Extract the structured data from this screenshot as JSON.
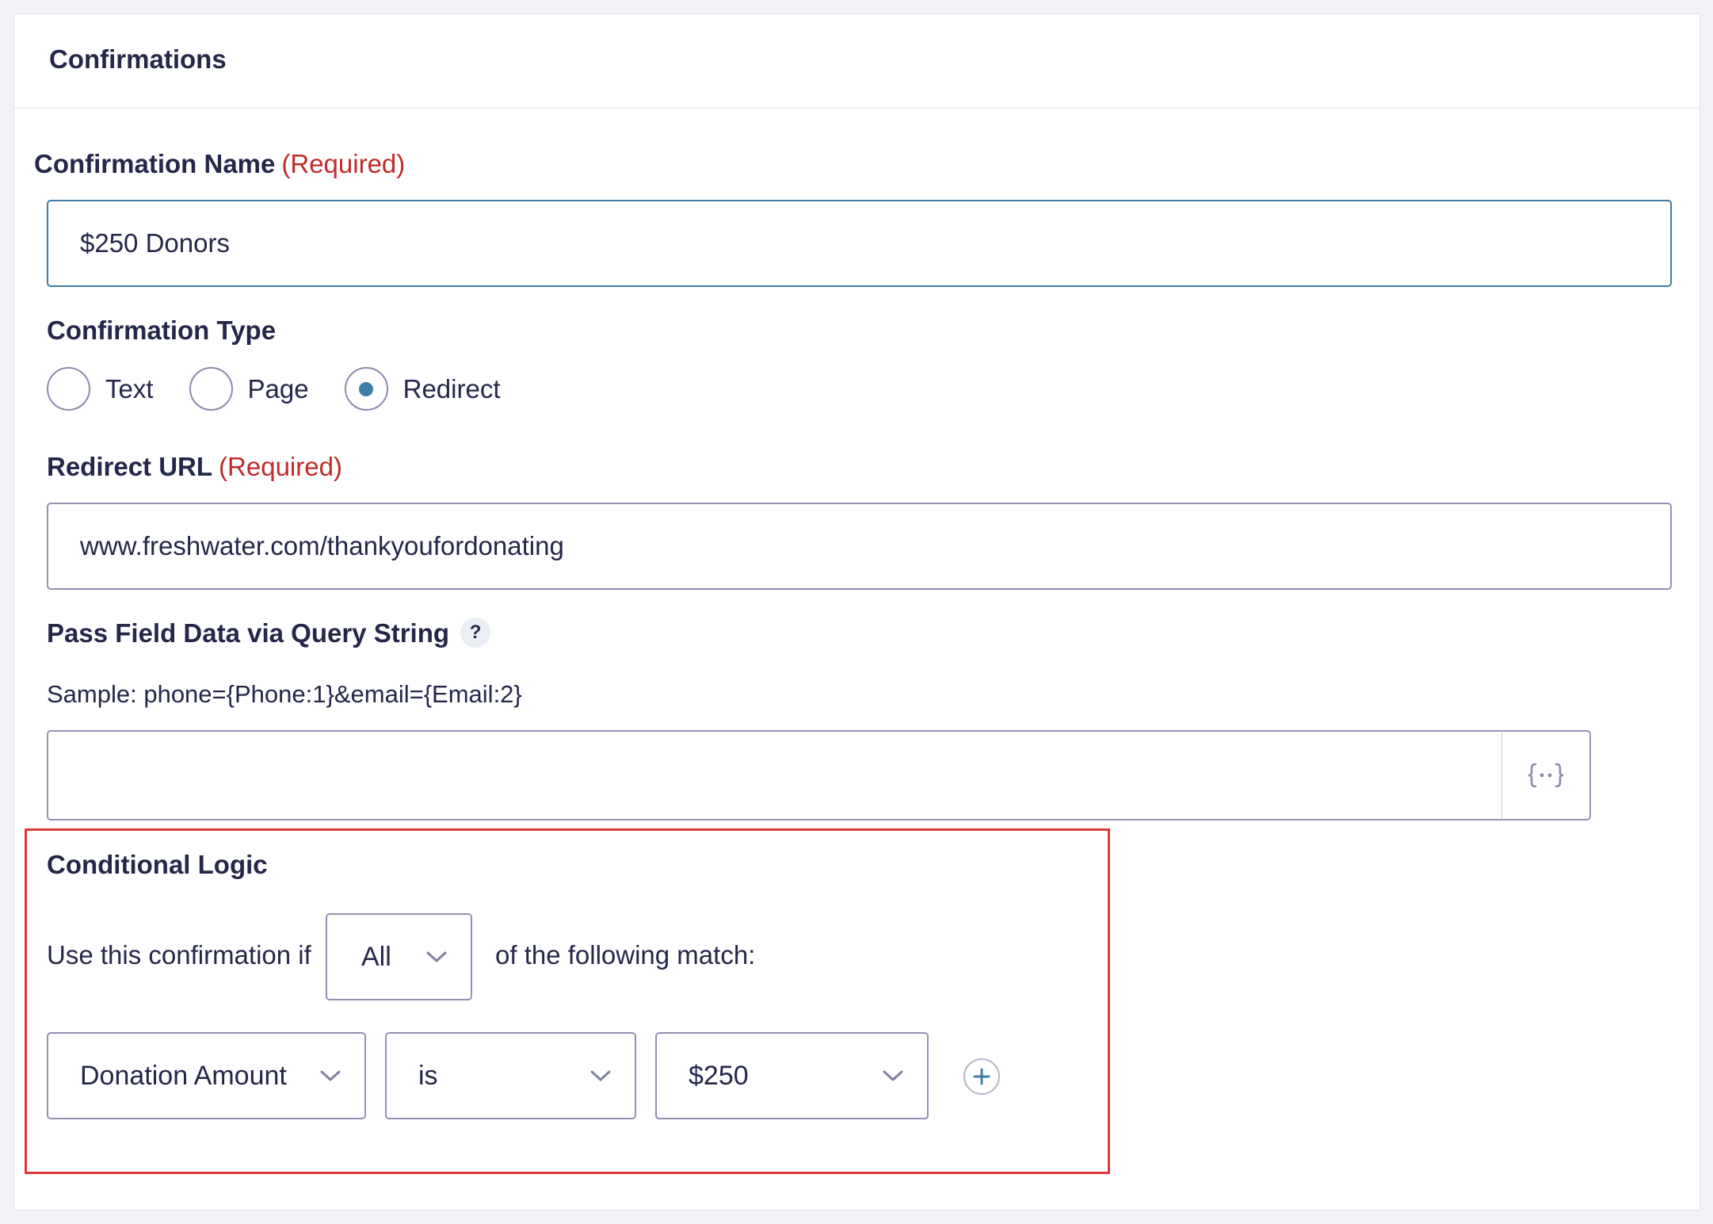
{
  "panel": {
    "title": "Confirmations"
  },
  "confirmation_name": {
    "label": "Confirmation Name",
    "required": "(Required)",
    "value": "$250 Donors"
  },
  "confirmation_type": {
    "label": "Confirmation Type",
    "options": [
      {
        "label": "Text",
        "checked": false
      },
      {
        "label": "Page",
        "checked": false
      },
      {
        "label": "Redirect",
        "checked": true
      }
    ]
  },
  "redirect_url": {
    "label": "Redirect URL",
    "required": "(Required)",
    "value": "www.freshwater.com/thankyoufordonating"
  },
  "query_string": {
    "label": "Pass Field Data via Query String",
    "help_icon": "?",
    "sample": "Sample: phone={Phone:1}&email={Email:2}",
    "value": "",
    "merge_tag_icon": "{..}"
  },
  "conditional_logic": {
    "label": "Conditional Logic",
    "prefix": "Use this confirmation if",
    "match_value": "All",
    "suffix": "of the following match:",
    "rule": {
      "field": "Donation Amount",
      "operator": "is",
      "value": "$250"
    },
    "highlight_color": "#e0373b"
  },
  "colors": {
    "accent": "#3e7da6",
    "required": "#c02b2b",
    "text": "#242748",
    "border": "#9092b2"
  }
}
